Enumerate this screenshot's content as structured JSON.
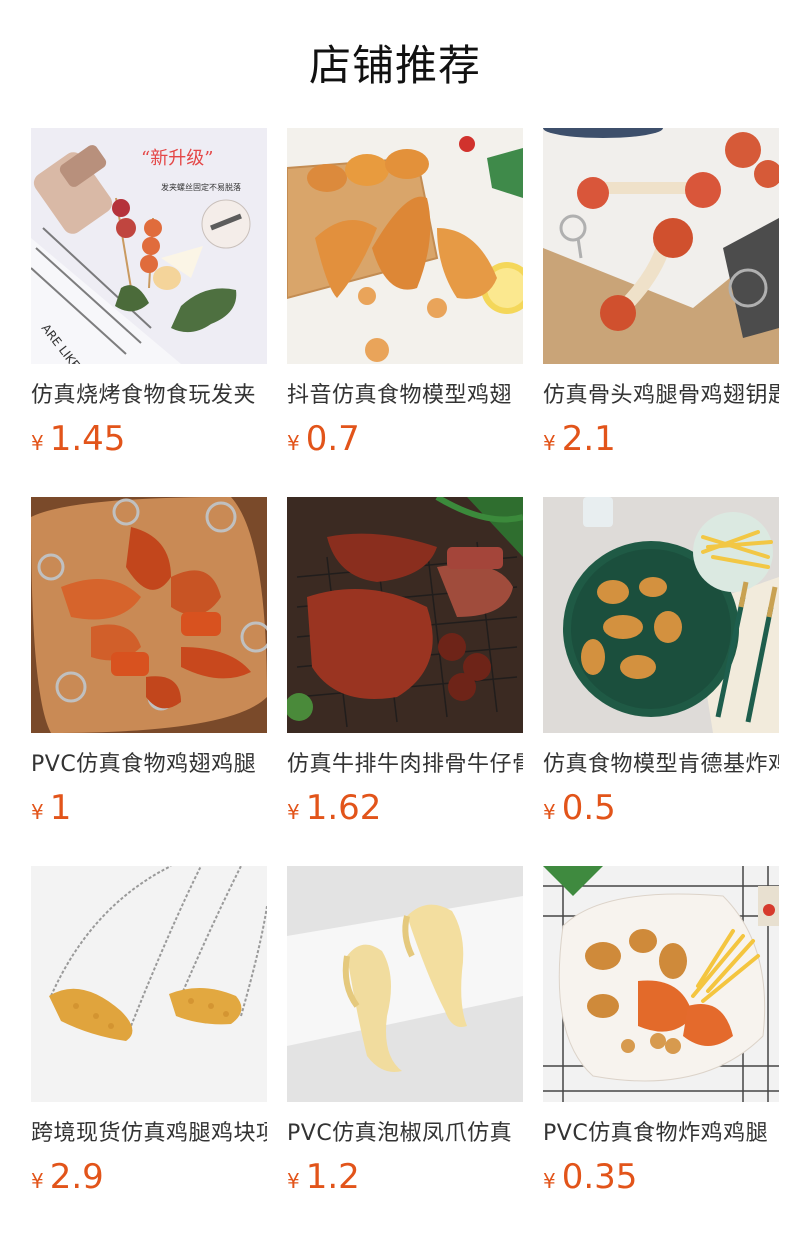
{
  "page": {
    "title": "店铺推荐",
    "currency_symbol": "¥",
    "accent_color": "#e2541a"
  },
  "products": [
    {
      "name": "仿真烧烤食物食玩发夹",
      "price": "1.45",
      "image": "bbq-hairclip-photo"
    },
    {
      "name": "抖音仿真食物模型鸡翅",
      "price": "0.7",
      "image": "roast-wings-photo"
    },
    {
      "name": "仿真骨头鸡腿骨鸡翅钥匙扣",
      "price": "2.1",
      "image": "drumstick-bone-keychain-photo"
    },
    {
      "name": "PVC仿真食物鸡翅鸡腿",
      "price": "1",
      "image": "chicken-keychain-photo"
    },
    {
      "name": "仿真牛排牛肉排骨牛仔骨",
      "price": "1.62",
      "image": "steak-ribs-photo"
    },
    {
      "name": "仿真食物模型肯德基炸鸡",
      "price": "0.5",
      "image": "fried-chicken-plate-photo"
    },
    {
      "name": "跨境现货仿真鸡腿鸡块项链",
      "price": "2.9",
      "image": "nugget-necklace-photo"
    },
    {
      "name": "PVC仿真泡椒凤爪仿真",
      "price": "1.2",
      "image": "chicken-feet-photo"
    },
    {
      "name": "PVC仿真食物炸鸡鸡腿",
      "price": "0.35",
      "image": "fried-chicken-basket-photo"
    }
  ]
}
